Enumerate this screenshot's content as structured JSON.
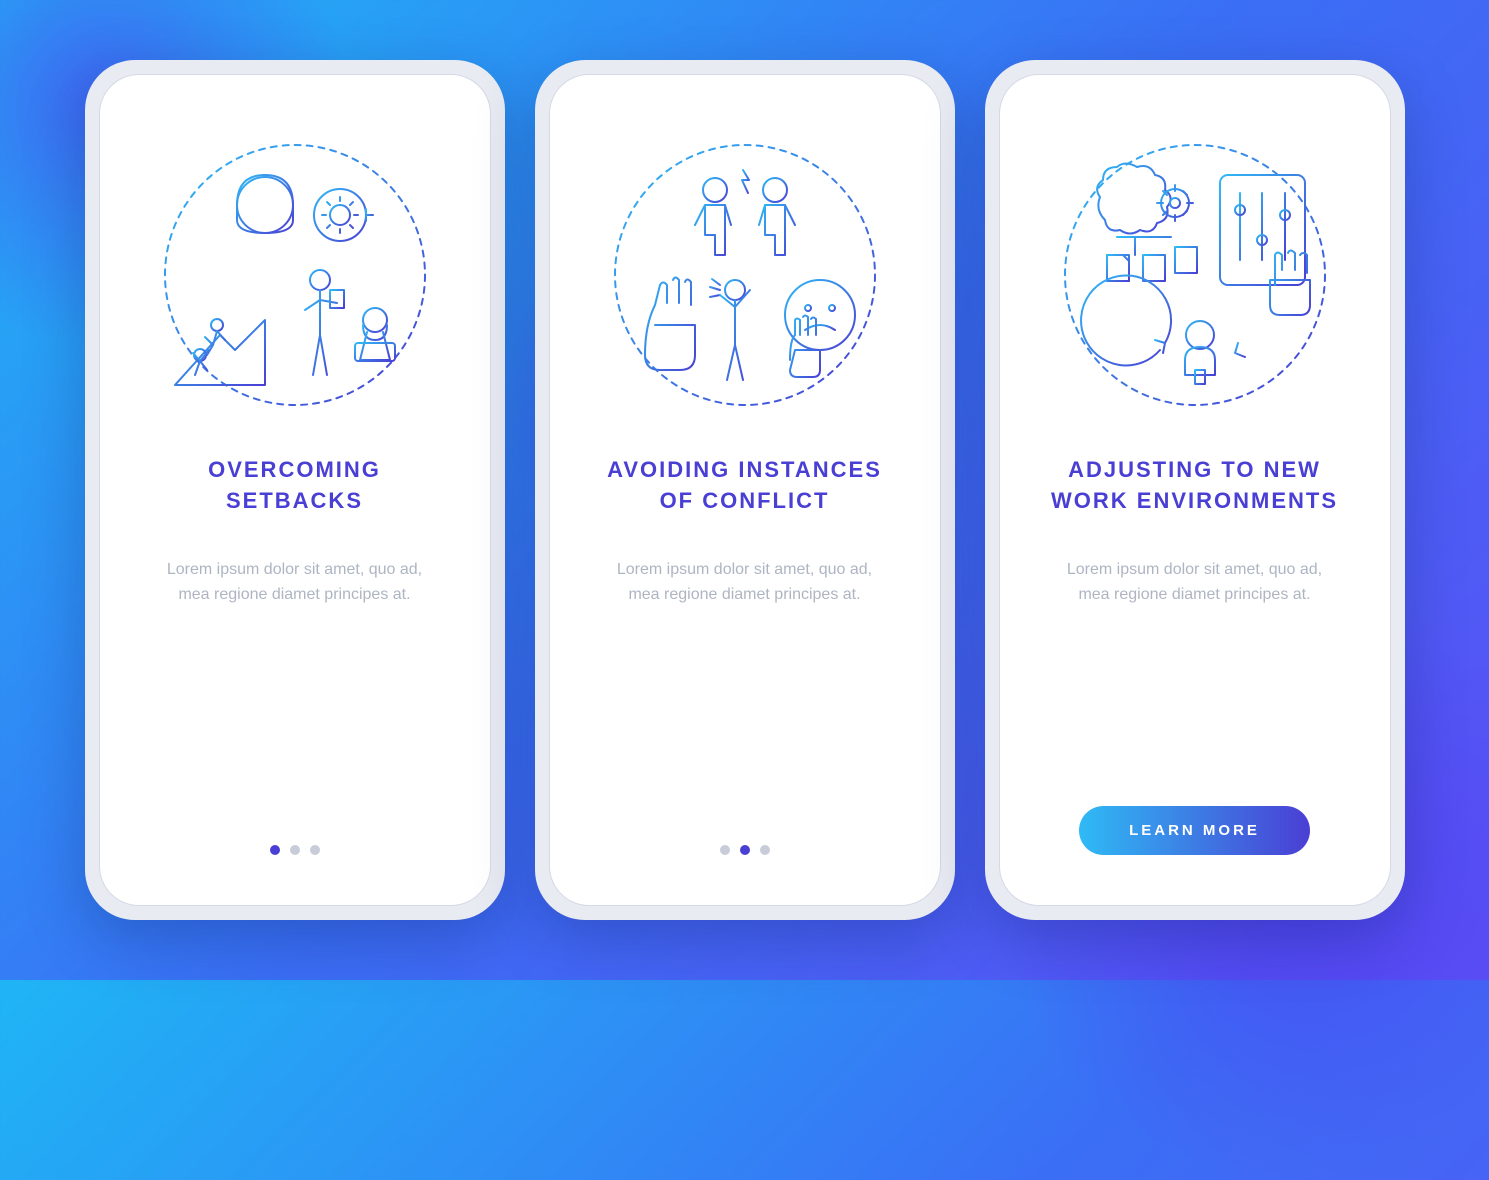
{
  "colors": {
    "accent": "#4a3fd4",
    "gradient_start": "#2fbaf5",
    "gradient_end": "#4a3fd4",
    "muted_text": "#aeb5c2",
    "dot_inactive": "#c8ccd8"
  },
  "screens": [
    {
      "icon": "overcoming-setbacks-illustration",
      "headline": "OVERCOMING SETBACKS",
      "body": "Lorem ipsum dolor sit amet, quo ad, mea regione diamet principes at.",
      "page_index": 0,
      "total_pages": 3,
      "show_cta": false
    },
    {
      "icon": "avoiding-conflict-illustration",
      "headline": "AVOIDING INSTANCES OF CONFLICT",
      "body": "Lorem ipsum dolor sit amet, quo ad, mea regione diamet principes at.",
      "page_index": 1,
      "total_pages": 3,
      "show_cta": false
    },
    {
      "icon": "adjusting-work-illustration",
      "headline": "ADJUSTING TO NEW WORK ENVIRONMENTS",
      "body": "Lorem ipsum dolor sit amet, quo ad, mea regione diamet principes at.",
      "page_index": 2,
      "total_pages": 3,
      "show_cta": true
    }
  ],
  "cta_label": "LEARN MORE"
}
